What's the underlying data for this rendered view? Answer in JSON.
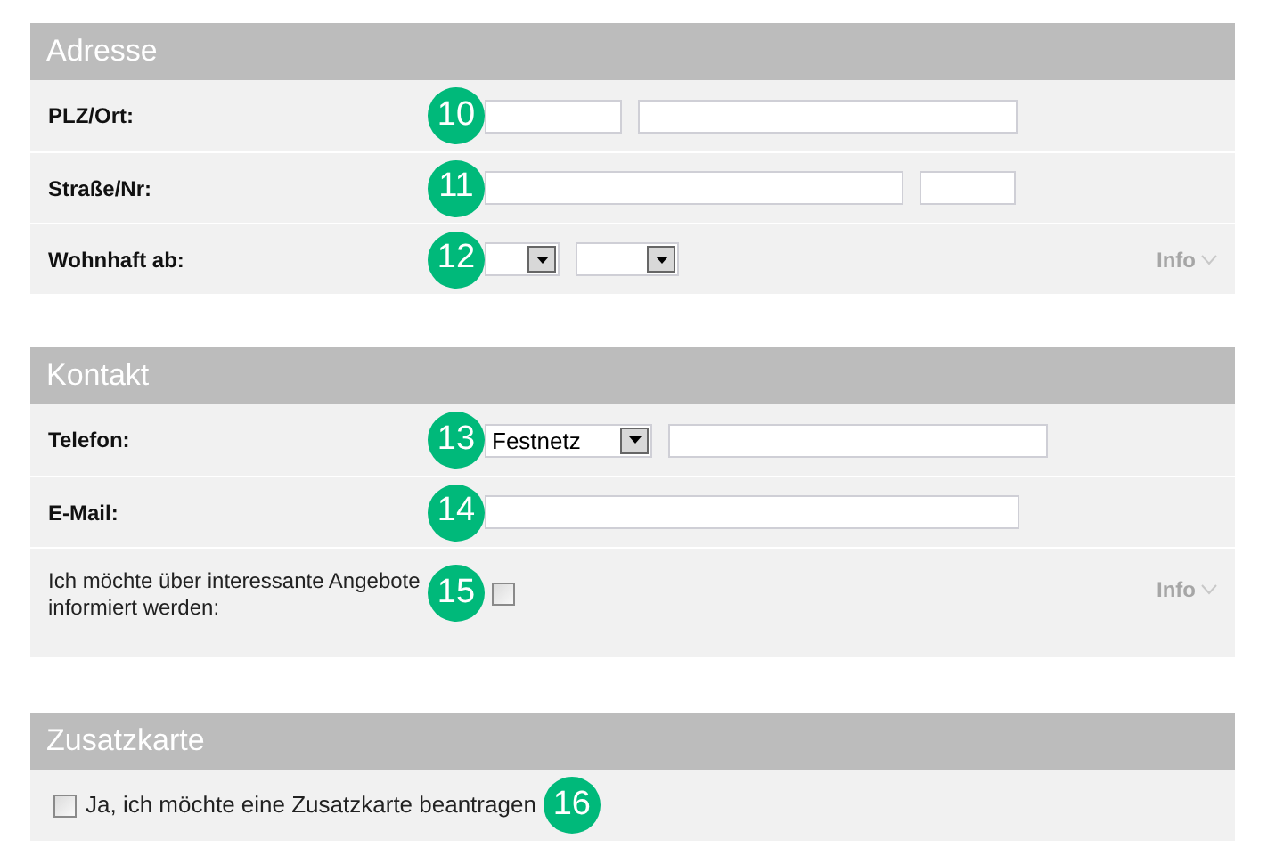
{
  "sections": [
    {
      "title": "Adresse",
      "rows": [
        {
          "kind": "field",
          "label": "PLZ/Ort:",
          "badge": "10",
          "controls": [
            {
              "kind": "text"
            },
            {
              "kind": "text"
            }
          ]
        },
        {
          "kind": "field",
          "label": "Straße/Nr:",
          "badge": "11",
          "controls": [
            {
              "kind": "text"
            },
            {
              "kind": "text"
            }
          ]
        },
        {
          "kind": "field",
          "label": "Wohnhaft ab:",
          "badge": "12",
          "controls": [
            {
              "kind": "select"
            },
            {
              "kind": "select"
            }
          ],
          "info": "Info"
        }
      ]
    },
    {
      "title": "Kontakt",
      "rows": [
        {
          "kind": "field",
          "label": "Telefon:",
          "badge": "13",
          "controls": [
            {
              "kind": "select",
              "value": "Festnetz"
            },
            {
              "kind": "text"
            }
          ]
        },
        {
          "kind": "field",
          "label": "E-Mail:",
          "badge": "14",
          "controls": [
            {
              "kind": "text"
            }
          ]
        },
        {
          "kind": "consent",
          "label": "Ich möchte über interessante Angebote informiert werden:",
          "badge": "15",
          "controls": [
            {
              "kind": "checkbox",
              "checked": false
            }
          ],
          "info": "Info"
        }
      ]
    },
    {
      "title": "Zusatzkarte",
      "rows": [
        {
          "kind": "checkbox_line",
          "label": "Ja, ich möchte eine Zusatzkarte beantragen",
          "badge": "16",
          "checked": false
        }
      ]
    }
  ]
}
